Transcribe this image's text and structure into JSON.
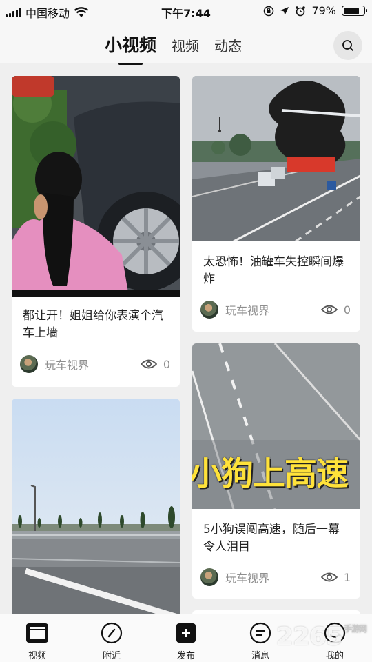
{
  "status_bar": {
    "carrier": "中国移动",
    "time": "下午7:44",
    "battery": "79%",
    "battery_level": 0.79
  },
  "header": {
    "tabs": [
      {
        "label": "小视频",
        "active": true
      },
      {
        "label": "视频",
        "active": false
      },
      {
        "label": "动态",
        "active": false
      }
    ],
    "search_icon": "search-icon"
  },
  "feed": {
    "cards": [
      {
        "title": "都让开！姐姐给你表演个汽车上墙",
        "author": "玩车视界",
        "views": "0"
      },
      {
        "title": "太恐怖！油罐车失控瞬间爆炸",
        "author": "玩车视界",
        "views": "0"
      },
      {
        "title": "",
        "author": "",
        "views": ""
      },
      {
        "title": "5小狗误闯高速，随后一幕令人泪目",
        "author": "玩车视界",
        "views": "1",
        "thumb_caption": "小狗上高速"
      }
    ]
  },
  "bottom_nav": {
    "items": [
      {
        "label": "视频",
        "icon": "video-icon"
      },
      {
        "label": "附近",
        "icon": "compass-icon"
      },
      {
        "label": "发布",
        "icon": "plus-icon"
      },
      {
        "label": "消息",
        "icon": "message-icon"
      },
      {
        "label": "我的",
        "icon": "profile-icon"
      }
    ]
  },
  "watermark": {
    "text": "2265",
    "sub": "手游网"
  }
}
